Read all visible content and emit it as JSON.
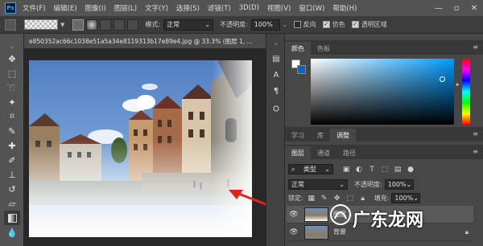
{
  "app": {
    "logo": "Ps"
  },
  "menu": [
    "文件(F)",
    "编辑(E)",
    "图像(I)",
    "图层(L)",
    "文字(Y)",
    "选择(S)",
    "滤镜(T)",
    "3D(D)",
    "视图(V)",
    "窗口(W)",
    "帮助(H)"
  ],
  "window_controls": [
    "—",
    "▫",
    "✕"
  ],
  "options": {
    "mode_label": "模式:",
    "mode_value": "正常",
    "opacity_label": "不透明度:",
    "opacity_value": "100%",
    "reverse_label": "反向",
    "reverse_checked": false,
    "dither_label": "仿色",
    "dither_checked": true,
    "transparency_label": "透明区域",
    "transparency_checked": true
  },
  "document": {
    "tab_title": "e850352ac66c1038e51a5a34e8119313b17e89e4.jpg @ 33.3% (图层 1, ..."
  },
  "color_panel": {
    "tabs": [
      "颜色",
      "色板"
    ],
    "selected_tab": "颜色",
    "accent": "#009bff"
  },
  "adjust_tabs": [
    "学习",
    "库",
    "调整"
  ],
  "layers_panel": {
    "tabs": [
      "图层",
      "通道",
      "路径"
    ],
    "filter_value": "类型",
    "blend_mode": "正常",
    "opacity_label": "不透明度:",
    "opacity_value": "100%",
    "lock_label": "锁定:",
    "fill_label": "填充:",
    "fill_value": "100%",
    "layers": [
      {
        "name": "图层 1",
        "selected": true
      },
      {
        "name": "背景",
        "selected": false
      }
    ]
  },
  "watermark": {
    "text": "广东龙网"
  }
}
